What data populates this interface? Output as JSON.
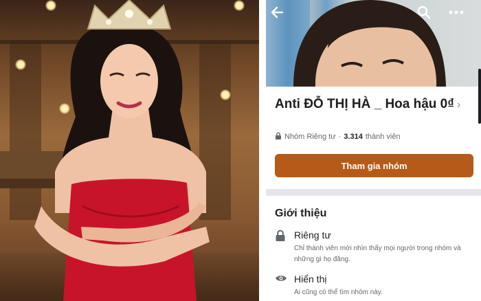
{
  "group": {
    "name": "Anti ĐỖ THỊ HÀ _ Hoa hậu 0₫",
    "chevron": "›",
    "privacy_label": "Nhóm Riêng tư",
    "separator": "·",
    "member_count": "3.314",
    "member_label": "thành viên"
  },
  "actions": {
    "join_label": "Tham gia nhóm"
  },
  "icons": {
    "back": "arrow-left-icon",
    "search": "search-icon",
    "more": "more-horizontal-icon",
    "privacy": "lock-icon",
    "visibility": "eye-icon"
  },
  "about": {
    "heading": "Giới thiệu",
    "items": [
      {
        "title": "Riêng tư",
        "description": "Chỉ thành viên mới nhìn thấy mọi người trong nhóm và những gì họ đăng."
      },
      {
        "title": "Hiển thị",
        "description": "Ai cũng có thể tìm nhóm này."
      }
    ]
  },
  "colors": {
    "join_button": "#b55a18",
    "section_divider": "#e4e6eb",
    "primary_text": "#1c1e21",
    "secondary_text": "#65676b"
  }
}
